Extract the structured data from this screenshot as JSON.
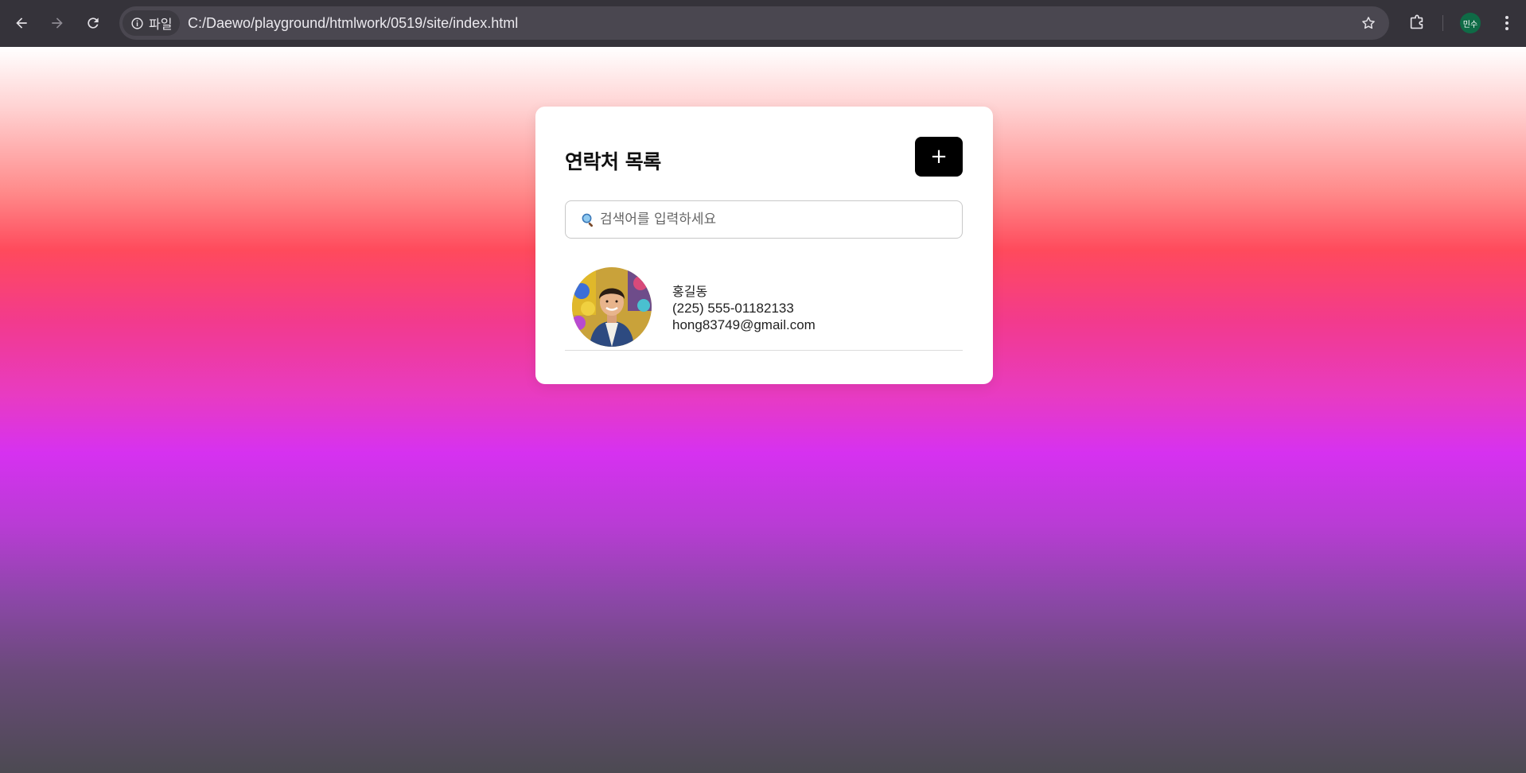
{
  "browser": {
    "site_chip_label": "파일",
    "url": "C:/Daewo/playground/htmlwork/0519/site/index.html",
    "profile_initials": "민수"
  },
  "colors": {
    "chrome_bg": "#35333a",
    "card_bg": "#ffffff",
    "add_button_bg": "#000000"
  },
  "page": {
    "title": "연락처 목록",
    "add_button_label": "+",
    "search": {
      "placeholder": "검색어를 입력하세요",
      "value": ""
    },
    "contacts": [
      {
        "name": "홍길동",
        "phone": "(225) 555-01182133",
        "email": "hong83749@gmail.com"
      }
    ]
  }
}
